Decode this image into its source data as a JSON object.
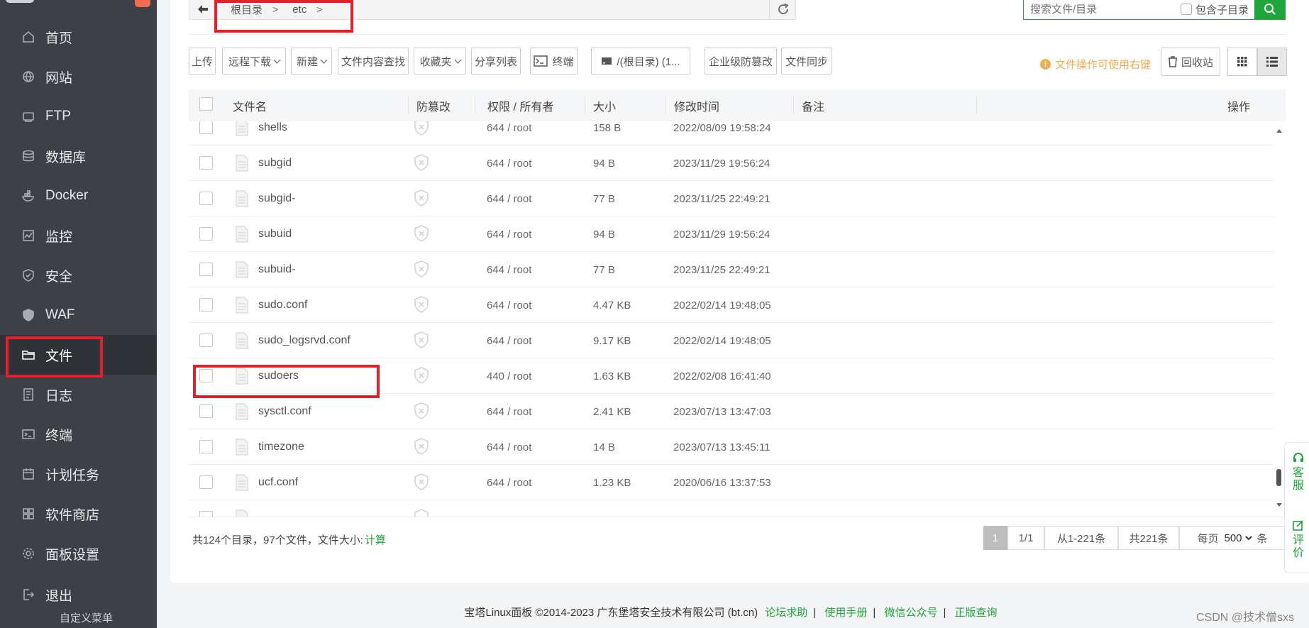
{
  "sidebar": {
    "items": [
      {
        "label": "首页",
        "icon": "home-icon"
      },
      {
        "label": "网站",
        "icon": "globe-icon"
      },
      {
        "label": "FTP",
        "icon": "ftp-icon"
      },
      {
        "label": "数据库",
        "icon": "database-icon"
      },
      {
        "label": "Docker",
        "icon": "docker-icon"
      },
      {
        "label": "监控",
        "icon": "monitor-icon"
      },
      {
        "label": "安全",
        "icon": "shield-icon"
      },
      {
        "label": "WAF",
        "icon": "waf-icon"
      },
      {
        "label": "文件",
        "icon": "folder-icon",
        "active": true
      },
      {
        "label": "日志",
        "icon": "log-icon"
      },
      {
        "label": "终端",
        "icon": "terminal-icon"
      },
      {
        "label": "计划任务",
        "icon": "calendar-icon"
      },
      {
        "label": "软件商店",
        "icon": "grid-icon"
      },
      {
        "label": "面板设置",
        "icon": "settings-icon"
      },
      {
        "label": "退出",
        "icon": "logout-icon"
      }
    ],
    "sub_label": "自定义菜单"
  },
  "path": {
    "crumbs": [
      "根目录",
      "etc"
    ]
  },
  "search": {
    "placeholder": "搜索文件/目录",
    "include_sub": "包含子目录"
  },
  "toolbar": {
    "upload": "上传",
    "remote_download": "远程下载",
    "new": "新建",
    "content_search": "文件内容查找",
    "favorites": "收藏夹",
    "share_list": "分享列表",
    "terminal": "终端",
    "disk": "/(根目录) (1...",
    "tamper": "企业级防篡改",
    "sync": "文件同步",
    "tip": "文件操作可使用右键",
    "recycle": "回收站"
  },
  "table": {
    "headers": {
      "name": "文件名",
      "tamper": "防篡改",
      "perm": "权限 / 所有者",
      "size": "大小",
      "mtime": "修改时间",
      "note": "备注",
      "ops": "操作"
    },
    "rows": [
      {
        "name": "shells",
        "perm": "644 / root",
        "size": "158 B",
        "mtime": "2022/08/09 19:58:24"
      },
      {
        "name": "subgid",
        "perm": "644 / root",
        "size": "94 B",
        "mtime": "2023/11/29 19:56:24"
      },
      {
        "name": "subgid-",
        "perm": "644 / root",
        "size": "77 B",
        "mtime": "2023/11/25 22:49:21"
      },
      {
        "name": "subuid",
        "perm": "644 / root",
        "size": "94 B",
        "mtime": "2023/11/29 19:56:24"
      },
      {
        "name": "subuid-",
        "perm": "644 / root",
        "size": "77 B",
        "mtime": "2023/11/25 22:49:21"
      },
      {
        "name": "sudo.conf",
        "perm": "644 / root",
        "size": "4.47 KB",
        "mtime": "2022/02/14 19:48:05"
      },
      {
        "name": "sudo_logsrvd.conf",
        "perm": "644 / root",
        "size": "9.17 KB",
        "mtime": "2022/02/14 19:48:05"
      },
      {
        "name": "sudoers",
        "perm": "440 / root",
        "size": "1.63 KB",
        "mtime": "2022/02/08 16:41:40"
      },
      {
        "name": "sysctl.conf",
        "perm": "644 / root",
        "size": "2.41 KB",
        "mtime": "2023/07/13 13:47:03"
      },
      {
        "name": "timezone",
        "perm": "644 / root",
        "size": "14 B",
        "mtime": "2023/07/13 13:45:11"
      },
      {
        "name": "ucf.conf",
        "perm": "644 / root",
        "size": "1.23 KB",
        "mtime": "2020/06/16 13:37:53"
      }
    ]
  },
  "footer_summary": {
    "text": "共124个目录，97个文件，文件大小:",
    "calc": "计算"
  },
  "pager": {
    "current": "1",
    "pages": "1/1",
    "range": "从1-221条",
    "total": "共221条",
    "per_page_label": "每页",
    "per_page": "500",
    "unit": "条"
  },
  "footer": {
    "copyright": "宝塔Linux面板 ©2014-2023 广东堡塔安全技术有限公司 (bt.cn)",
    "links": [
      "论坛求助",
      "使用手册",
      "微信公众号",
      "正版查询"
    ],
    "sep": "|"
  },
  "watermark": "CSDN @技术僧sxs",
  "float": {
    "service": "客服",
    "review": "评价"
  },
  "colors": {
    "accent": "#20a53a",
    "sidebar_bg": "#3d4147",
    "highlight": "#e6202a",
    "warning": "#f0ad4e"
  }
}
